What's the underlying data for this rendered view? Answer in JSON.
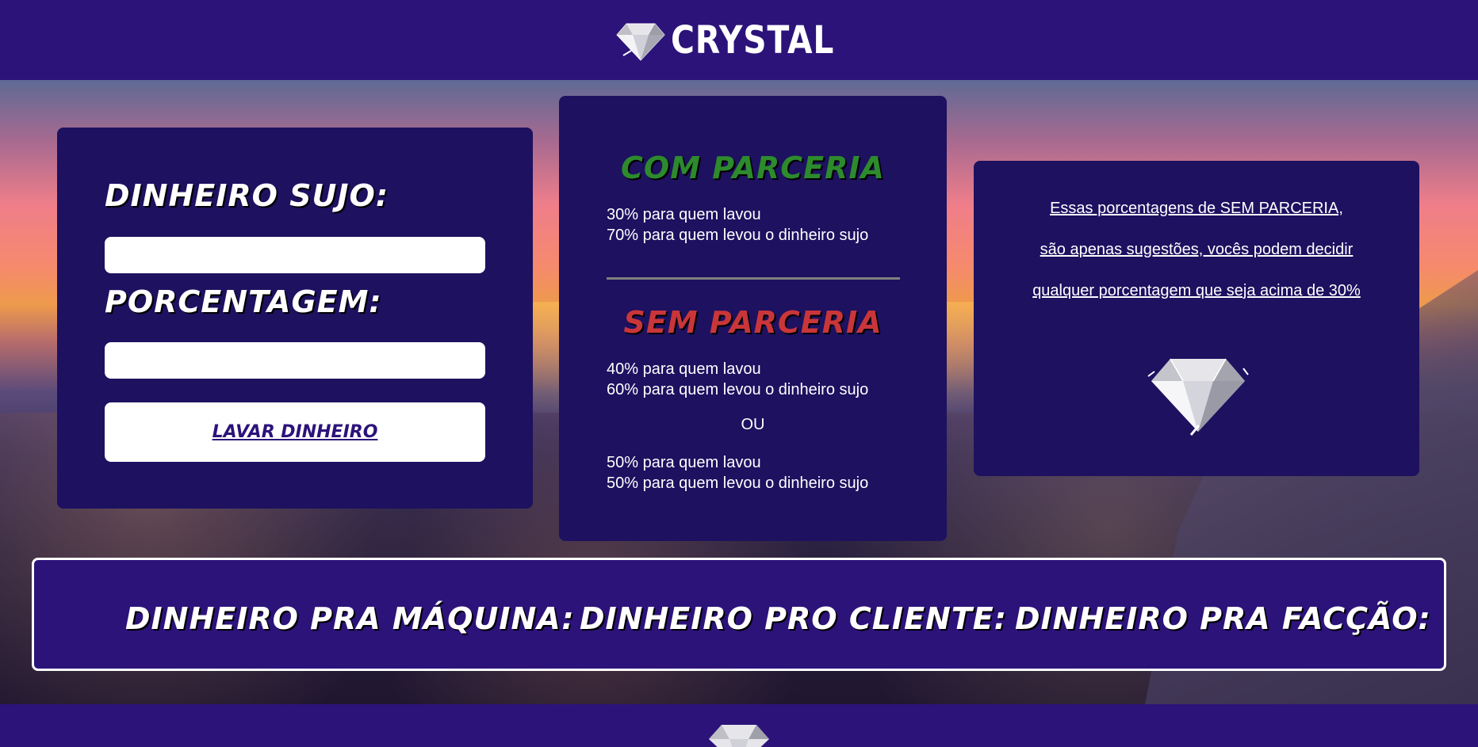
{
  "header": {
    "logo_text": "CRYSTAL",
    "logo_icon": "diamond-icon"
  },
  "form": {
    "dirty_money_label": "DINHEIRO SUJO:",
    "dirty_money_value": "",
    "percentage_label": "PORCENTAGEM:",
    "percentage_value": "",
    "wash_button_label": "LAVAR DINHEIRO"
  },
  "info": {
    "with_partnership": {
      "title": "COM PARCERIA",
      "lines": [
        "30% para quem lavou",
        "70% para quem levou o dinheiro sujo"
      ]
    },
    "without_partnership": {
      "title": "SEM PARCERIA",
      "option_a": [
        "40% para quem lavou",
        "60% para quem levou o dinheiro sujo"
      ],
      "or_label": "OU",
      "option_b": [
        "50% para quem lavou",
        "50% para quem levou o dinheiro sujo"
      ]
    }
  },
  "note": {
    "lines": [
      "Essas porcentagens de SEM PARCERIA,",
      "são apenas sugestões, vocês podem decidir",
      "qualquer porcentagem que seja acima de 30%"
    ],
    "icon": "diamond-icon"
  },
  "results": {
    "machine_label": "DINHEIRO PRA MÁQUINA:",
    "client_label": "DINHEIRO PRO CLIENTE:",
    "faction_label": "DINHEIRO PRA FACÇÃO:"
  },
  "colors": {
    "header_bg": "#2c137a",
    "panel_bg": "#1d1160",
    "with_partnership": "#2d8a2d",
    "without_partnership": "#c9363a"
  }
}
